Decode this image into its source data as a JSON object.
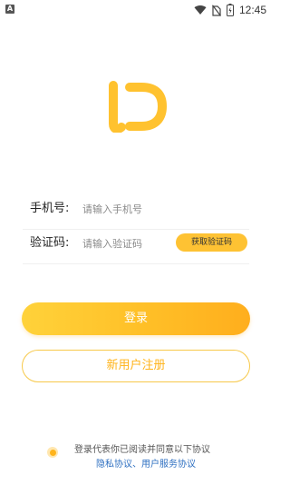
{
  "status_bar": {
    "time": "12:45",
    "left_icon_letter": "A"
  },
  "form": {
    "phone_label": "手机号:",
    "phone_placeholder": "请输入手机号",
    "code_label": "验证码:",
    "code_placeholder": "请输入验证码",
    "get_code_button": "获取验证码"
  },
  "actions": {
    "login": "登录",
    "register": "新用户注册"
  },
  "agreement": {
    "text": "登录代表你已阅读并同意以下协议",
    "privacy": "隐私协议、",
    "service": "用户服务协议"
  },
  "colors": {
    "accent": "#FFC02C",
    "link": "#2D6FC1"
  }
}
